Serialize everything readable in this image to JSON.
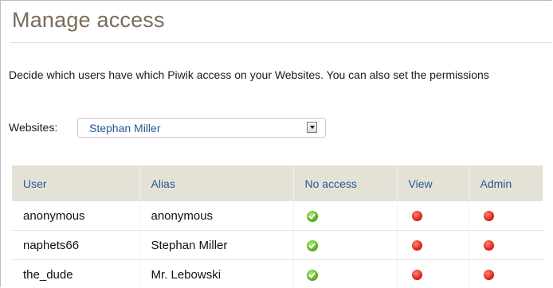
{
  "page": {
    "title": "Manage access",
    "description": "Decide which users have which Piwik access on your Websites. You can also set the permissions"
  },
  "websites": {
    "label": "Websites:",
    "selected": "Stephan Miller"
  },
  "table": {
    "headers": [
      "User",
      "Alias",
      "No access",
      "View",
      "Admin"
    ],
    "rows": [
      {
        "user": "anonymous",
        "alias": "anonymous",
        "access": "noaccess"
      },
      {
        "user": "naphets66",
        "alias": "Stephan Miller",
        "access": "noaccess"
      },
      {
        "user": "the_dude",
        "alias": "Mr. Lebowski",
        "access": "noaccess"
      }
    ]
  },
  "icons": {
    "selected": "green-check-circle-icon",
    "unselected": "red-dot-icon"
  },
  "colors": {
    "title": "#7a6b5a",
    "link": "#255792",
    "header_bg": "#e4e2d7"
  }
}
